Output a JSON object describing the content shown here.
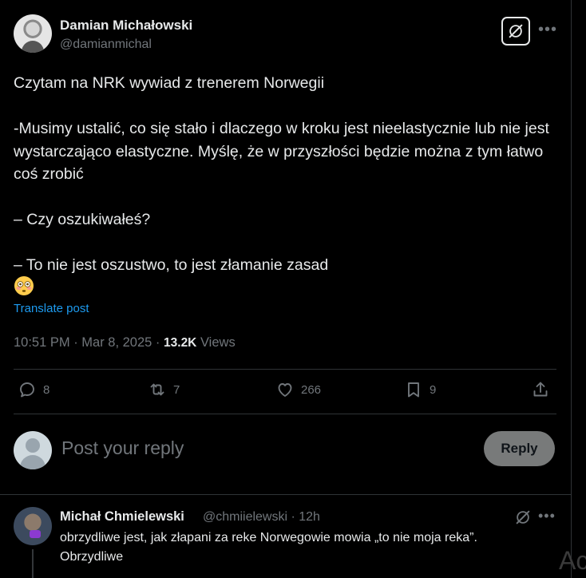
{
  "tweet": {
    "author_name": "Damian Michałowski",
    "author_handle": "@damianmichal",
    "text": "Czytam na NRK wywiad z trenerem Norwegii\n\n-Musimy ustalić, co się stało i dlaczego w kroku jest nieelastycznie lub nie jest wystarczająco elastyczne. Myślę, że w przyszłości będzie można z tym łatwo coś zrobić\n\n– Czy oszukiwałeś?\n\n– To nie jest oszustwo, to jest złamanie zasad",
    "emoji_icon": "flushed-face-icon",
    "translate_label": "Translate post",
    "timestamp": "10:51 PM · Mar 8, 2025 · ",
    "views_count": "13.2K",
    "views_label": " Views",
    "more_icon": "more-icon",
    "grok_icon": "grok-icon"
  },
  "actions": {
    "replies": "8",
    "reposts": "7",
    "likes": "266",
    "bookmarks": "9"
  },
  "composer": {
    "placeholder": "Post your reply",
    "reply_button": "Reply"
  },
  "reply": {
    "author_name": "Michał Chmielewski",
    "handle_time": "@chmiielewski · 12h",
    "text": "obrzydliwe jest, jak złapani za reke Norwegowie mowia „to nie moja reka”.\nObrzydliwe"
  },
  "edge_text": "Ac",
  "colors": {
    "background": "#000000",
    "text": "#e7e9ea",
    "secondary": "#71767b",
    "link": "#1d9bf0",
    "border": "#2f3336",
    "reply_button_bg": "#787a7a"
  }
}
